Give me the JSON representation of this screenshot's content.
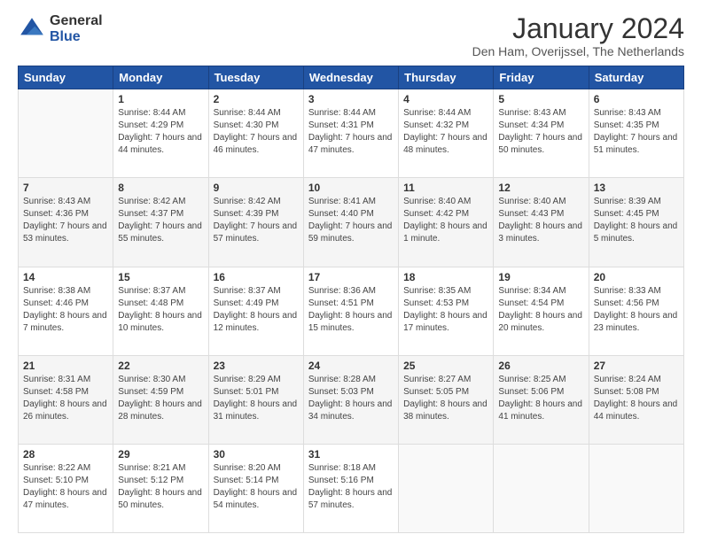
{
  "header": {
    "logo": {
      "line1": "General",
      "line2": "Blue"
    },
    "title": "January 2024",
    "subtitle": "Den Ham, Overijssel, The Netherlands"
  },
  "calendar": {
    "days_of_week": [
      "Sunday",
      "Monday",
      "Tuesday",
      "Wednesday",
      "Thursday",
      "Friday",
      "Saturday"
    ],
    "weeks": [
      [
        {
          "day": "",
          "sunrise": "",
          "sunset": "",
          "daylight": "",
          "empty": true
        },
        {
          "day": "1",
          "sunrise": "Sunrise: 8:44 AM",
          "sunset": "Sunset: 4:29 PM",
          "daylight": "Daylight: 7 hours and 44 minutes."
        },
        {
          "day": "2",
          "sunrise": "Sunrise: 8:44 AM",
          "sunset": "Sunset: 4:30 PM",
          "daylight": "Daylight: 7 hours and 46 minutes."
        },
        {
          "day": "3",
          "sunrise": "Sunrise: 8:44 AM",
          "sunset": "Sunset: 4:31 PM",
          "daylight": "Daylight: 7 hours and 47 minutes."
        },
        {
          "day": "4",
          "sunrise": "Sunrise: 8:44 AM",
          "sunset": "Sunset: 4:32 PM",
          "daylight": "Daylight: 7 hours and 48 minutes."
        },
        {
          "day": "5",
          "sunrise": "Sunrise: 8:43 AM",
          "sunset": "Sunset: 4:34 PM",
          "daylight": "Daylight: 7 hours and 50 minutes."
        },
        {
          "day": "6",
          "sunrise": "Sunrise: 8:43 AM",
          "sunset": "Sunset: 4:35 PM",
          "daylight": "Daylight: 7 hours and 51 minutes."
        }
      ],
      [
        {
          "day": "7",
          "sunrise": "Sunrise: 8:43 AM",
          "sunset": "Sunset: 4:36 PM",
          "daylight": "Daylight: 7 hours and 53 minutes."
        },
        {
          "day": "8",
          "sunrise": "Sunrise: 8:42 AM",
          "sunset": "Sunset: 4:37 PM",
          "daylight": "Daylight: 7 hours and 55 minutes."
        },
        {
          "day": "9",
          "sunrise": "Sunrise: 8:42 AM",
          "sunset": "Sunset: 4:39 PM",
          "daylight": "Daylight: 7 hours and 57 minutes."
        },
        {
          "day": "10",
          "sunrise": "Sunrise: 8:41 AM",
          "sunset": "Sunset: 4:40 PM",
          "daylight": "Daylight: 7 hours and 59 minutes."
        },
        {
          "day": "11",
          "sunrise": "Sunrise: 8:40 AM",
          "sunset": "Sunset: 4:42 PM",
          "daylight": "Daylight: 8 hours and 1 minute."
        },
        {
          "day": "12",
          "sunrise": "Sunrise: 8:40 AM",
          "sunset": "Sunset: 4:43 PM",
          "daylight": "Daylight: 8 hours and 3 minutes."
        },
        {
          "day": "13",
          "sunrise": "Sunrise: 8:39 AM",
          "sunset": "Sunset: 4:45 PM",
          "daylight": "Daylight: 8 hours and 5 minutes."
        }
      ],
      [
        {
          "day": "14",
          "sunrise": "Sunrise: 8:38 AM",
          "sunset": "Sunset: 4:46 PM",
          "daylight": "Daylight: 8 hours and 7 minutes."
        },
        {
          "day": "15",
          "sunrise": "Sunrise: 8:37 AM",
          "sunset": "Sunset: 4:48 PM",
          "daylight": "Daylight: 8 hours and 10 minutes."
        },
        {
          "day": "16",
          "sunrise": "Sunrise: 8:37 AM",
          "sunset": "Sunset: 4:49 PM",
          "daylight": "Daylight: 8 hours and 12 minutes."
        },
        {
          "day": "17",
          "sunrise": "Sunrise: 8:36 AM",
          "sunset": "Sunset: 4:51 PM",
          "daylight": "Daylight: 8 hours and 15 minutes."
        },
        {
          "day": "18",
          "sunrise": "Sunrise: 8:35 AM",
          "sunset": "Sunset: 4:53 PM",
          "daylight": "Daylight: 8 hours and 17 minutes."
        },
        {
          "day": "19",
          "sunrise": "Sunrise: 8:34 AM",
          "sunset": "Sunset: 4:54 PM",
          "daylight": "Daylight: 8 hours and 20 minutes."
        },
        {
          "day": "20",
          "sunrise": "Sunrise: 8:33 AM",
          "sunset": "Sunset: 4:56 PM",
          "daylight": "Daylight: 8 hours and 23 minutes."
        }
      ],
      [
        {
          "day": "21",
          "sunrise": "Sunrise: 8:31 AM",
          "sunset": "Sunset: 4:58 PM",
          "daylight": "Daylight: 8 hours and 26 minutes."
        },
        {
          "day": "22",
          "sunrise": "Sunrise: 8:30 AM",
          "sunset": "Sunset: 4:59 PM",
          "daylight": "Daylight: 8 hours and 28 minutes."
        },
        {
          "day": "23",
          "sunrise": "Sunrise: 8:29 AM",
          "sunset": "Sunset: 5:01 PM",
          "daylight": "Daylight: 8 hours and 31 minutes."
        },
        {
          "day": "24",
          "sunrise": "Sunrise: 8:28 AM",
          "sunset": "Sunset: 5:03 PM",
          "daylight": "Daylight: 8 hours and 34 minutes."
        },
        {
          "day": "25",
          "sunrise": "Sunrise: 8:27 AM",
          "sunset": "Sunset: 5:05 PM",
          "daylight": "Daylight: 8 hours and 38 minutes."
        },
        {
          "day": "26",
          "sunrise": "Sunrise: 8:25 AM",
          "sunset": "Sunset: 5:06 PM",
          "daylight": "Daylight: 8 hours and 41 minutes."
        },
        {
          "day": "27",
          "sunrise": "Sunrise: 8:24 AM",
          "sunset": "Sunset: 5:08 PM",
          "daylight": "Daylight: 8 hours and 44 minutes."
        }
      ],
      [
        {
          "day": "28",
          "sunrise": "Sunrise: 8:22 AM",
          "sunset": "Sunset: 5:10 PM",
          "daylight": "Daylight: 8 hours and 47 minutes."
        },
        {
          "day": "29",
          "sunrise": "Sunrise: 8:21 AM",
          "sunset": "Sunset: 5:12 PM",
          "daylight": "Daylight: 8 hours and 50 minutes."
        },
        {
          "day": "30",
          "sunrise": "Sunrise: 8:20 AM",
          "sunset": "Sunset: 5:14 PM",
          "daylight": "Daylight: 8 hours and 54 minutes."
        },
        {
          "day": "31",
          "sunrise": "Sunrise: 8:18 AM",
          "sunset": "Sunset: 5:16 PM",
          "daylight": "Daylight: 8 hours and 57 minutes."
        },
        {
          "day": "",
          "sunrise": "",
          "sunset": "",
          "daylight": "",
          "empty": true
        },
        {
          "day": "",
          "sunrise": "",
          "sunset": "",
          "daylight": "",
          "empty": true
        },
        {
          "day": "",
          "sunrise": "",
          "sunset": "",
          "daylight": "",
          "empty": true
        }
      ]
    ]
  }
}
